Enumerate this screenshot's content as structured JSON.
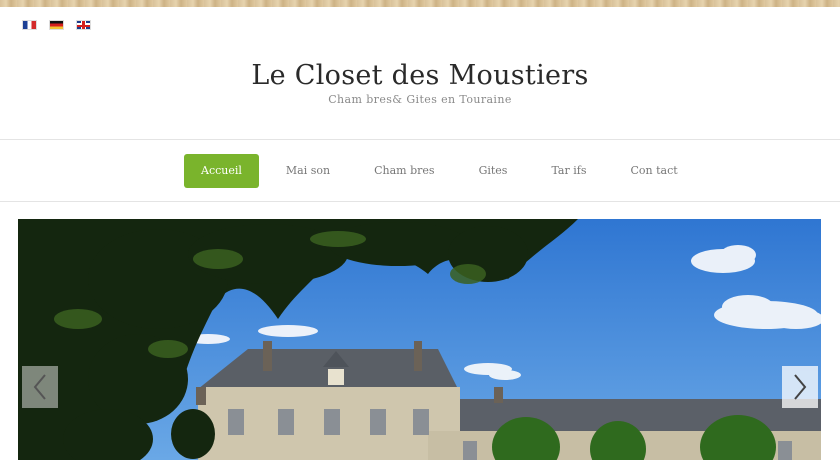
{
  "languages": [
    {
      "code": "fr",
      "label": "Français"
    },
    {
      "code": "de",
      "label": "Deutsch"
    },
    {
      "code": "en",
      "label": "English"
    }
  ],
  "site": {
    "title": "Le Closet des Moustiers",
    "tagline": "Cham bres& Gites en Touraine"
  },
  "nav": {
    "items": [
      {
        "label": "Accueil",
        "active": true
      },
      {
        "label": "Mai son",
        "active": false
      },
      {
        "label": "Cham bres",
        "active": false
      },
      {
        "label": "Gites",
        "active": false
      },
      {
        "label": "Tar ifs",
        "active": false
      },
      {
        "label": "Con tact",
        "active": false
      }
    ]
  },
  "slider": {
    "image": "manor-house-photo",
    "prev_icon": "chevron-left-icon",
    "next_icon": "chevron-right-icon"
  },
  "colors": {
    "accent": "#7ab42c",
    "sky": "#3f86d9"
  }
}
